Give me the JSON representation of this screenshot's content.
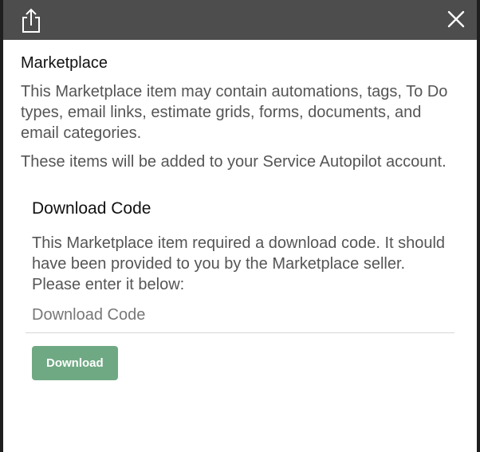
{
  "titlebar": {
    "share_icon": "share-upload-icon",
    "close_icon": "close-icon",
    "background_color": "#4d4d4d"
  },
  "marketplace": {
    "title": "Marketplace",
    "paragraph1": "This Marketplace item may contain automations, tags, To Do types, email links, estimate grids, forms, documents, and email categories.",
    "paragraph2": "These items will be added to your Service Autopilot account."
  },
  "download": {
    "heading": "Download Code",
    "description": "This Marketplace item required a download code. It should have been provided to you by the Marketplace seller. Please enter it below:",
    "input_placeholder": "Download Code",
    "input_value": "",
    "button_label": "Download",
    "button_color": "#6fa983"
  }
}
